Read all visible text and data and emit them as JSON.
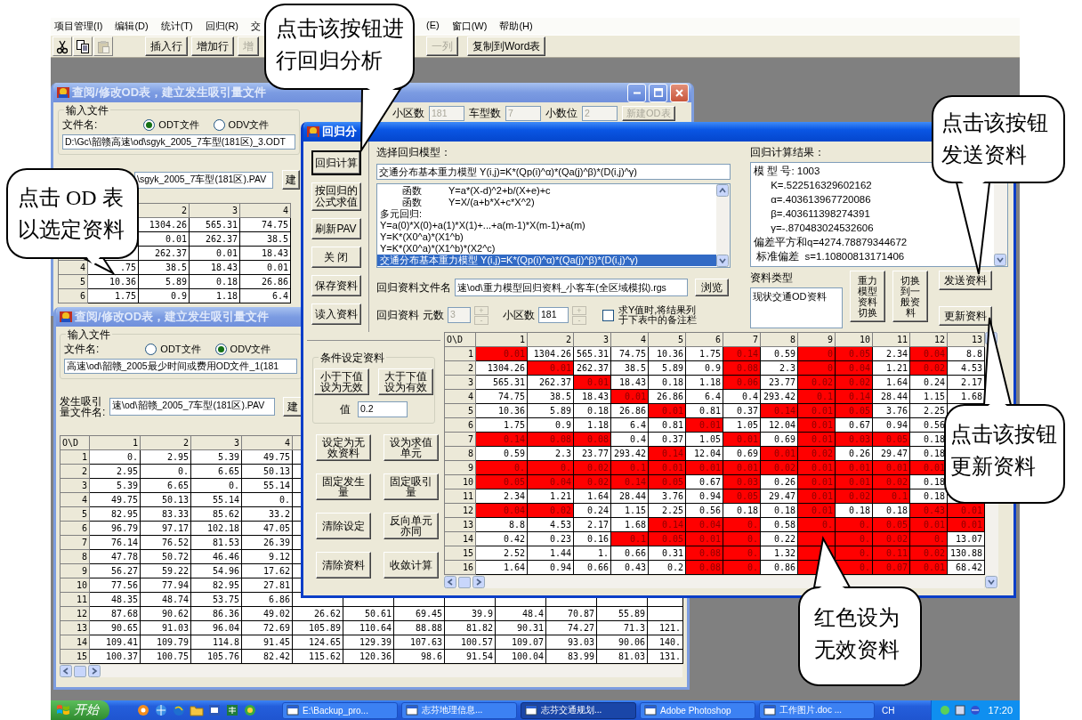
{
  "menu": {
    "left": [
      {
        "label": "项目管理(I)"
      },
      {
        "label": "编辑(D)"
      },
      {
        "label": "统计(T)"
      },
      {
        "label": "回归(R)"
      },
      {
        "label": "交"
      }
    ],
    "right": [
      {
        "label": "(E)"
      },
      {
        "label": "窗口(W)"
      },
      {
        "label": "帮助(H)"
      }
    ]
  },
  "toolbar": {
    "tools": [
      {
        "kind": "cut",
        "disabled": false
      },
      {
        "kind": "copy",
        "disabled": false
      },
      {
        "kind": "paste",
        "disabled": true
      }
    ],
    "left": [
      {
        "label": "插入行",
        "disabled": false
      },
      {
        "label": "增加行",
        "disabled": false
      },
      {
        "label": "增",
        "disabled": true
      }
    ],
    "right": [
      {
        "label": "一列",
        "disabled": true
      },
      {
        "label": "复制到Word表",
        "disabled": false
      }
    ]
  },
  "od_window": {
    "title": "查阅/修改OD表，建立发生吸引量文件",
    "group": "输入文件",
    "file_label": "文件名:",
    "radios": [
      {
        "label": "ODT文件",
        "selected": true
      },
      {
        "label": "ODV文件",
        "selected": false
      }
    ],
    "file": "D:\\Gc\\韶赣高速\\od\\sgyk_2005_7车型(181区)_3.ODT",
    "settings": [
      {
        "label": "小区数",
        "value": "181",
        "disabled": true
      },
      {
        "label": "车型数",
        "value": "7",
        "disabled": true
      },
      {
        "label": "小数位",
        "value": "2",
        "disabled": true
      }
    ],
    "new_button": {
      "label": "新建OD表",
      "disabled": true
    },
    "pav_file": "\\sgyk_2005_7车型(181区).PAV",
    "build_button": "建",
    "table": {
      "columns": [
        "2",
        "3",
        "4"
      ],
      "rows": [
        {
          "cells": [
            "1304.26",
            "565.31",
            "74.75"
          ]
        },
        {
          "cells": [
            "0.01",
            "262.37",
            "38.5"
          ]
        },
        {
          "cells": [
            "262.37",
            "0.01",
            "18.43"
          ]
        },
        {
          "header": "4",
          "first": ".75",
          "cells": [
            "38.5",
            "18.43",
            "0.01"
          ]
        },
        {
          "header": "5",
          "first": "10.36",
          "cells": [
            "5.89",
            "0.18",
            "26.86"
          ]
        },
        {
          "header": "6",
          "first": "1.75",
          "cells": [
            "0.9",
            "1.18",
            "6.4"
          ]
        }
      ]
    }
  },
  "od_window_front": {
    "title": "查阅/修改OD表，建立发生吸引量文件",
    "group": "输入文件",
    "file_label": "文件名:",
    "radios": [
      {
        "label": "ODT文件",
        "selected": false
      },
      {
        "label": "ODV文件",
        "selected": true
      }
    ],
    "file": "高速\\od\\韶赣_2005最少时间或费用OD文件_1(181",
    "pav_label": "发生吸引量文件名:",
    "pav_file": "速\\od\\韶赣_2005_7车型(181区).PAV",
    "build_button": "建",
    "table": {
      "corner": "O\\D",
      "columns": [
        "1",
        "2",
        "3",
        "4"
      ],
      "rows": [
        {
          "header": "1",
          "cells": [
            "0.",
            "2.95",
            "5.39",
            "49.75"
          ]
        },
        {
          "header": "2",
          "cells": [
            "2.95",
            "0.",
            "6.65",
            "50.13"
          ]
        },
        {
          "header": "3",
          "cells": [
            "5.39",
            "6.65",
            "0.",
            "55.14"
          ]
        },
        {
          "header": "4",
          "cells": [
            "49.75",
            "50.13",
            "55.14",
            "0."
          ]
        },
        {
          "header": "5",
          "cells": [
            "82.95",
            "83.33",
            "85.62",
            "33.2"
          ]
        },
        {
          "header": "6",
          "cells": [
            "96.79",
            "97.17",
            "102.18",
            "47.05"
          ]
        },
        {
          "header": "7",
          "cells": [
            "76.14",
            "76.52",
            "81.53",
            "26.39"
          ]
        },
        {
          "header": "8",
          "cells": [
            "47.78",
            "50.72",
            "46.46",
            "9.12"
          ]
        },
        {
          "header": "9",
          "cells": [
            "56.27",
            "59.22",
            "54.96",
            "17.62"
          ]
        },
        {
          "header": "10",
          "cells": [
            "77.56",
            "77.94",
            "82.95",
            "27.81"
          ]
        },
        {
          "header": "11",
          "cells": [
            "48.35",
            "48.74",
            "53.75",
            "6.86"
          ]
        },
        {
          "header": "12",
          "cells": [
            "87.68",
            "90.62",
            "86.36",
            "49.02",
            "26.62",
            "50.61",
            "69.45",
            "39.9",
            "48.4",
            "70.87",
            "55.89"
          ]
        },
        {
          "header": "13",
          "cells": [
            "90.65",
            "91.03",
            "96.04",
            "72.69",
            "105.89",
            "110.64",
            "88.88",
            "81.82",
            "90.31",
            "74.27",
            "71.3",
            "121."
          ]
        },
        {
          "header": "14",
          "cells": [
            "109.41",
            "109.79",
            "114.8",
            "91.45",
            "124.65",
            "129.39",
            "107.63",
            "100.57",
            "109.07",
            "93.03",
            "90.06",
            "140."
          ]
        },
        {
          "header": "15",
          "cells": [
            "100.37",
            "100.75",
            "105.76",
            "82.42",
            "115.62",
            "120.36",
            "98.6",
            "91.54",
            "100.04",
            "83.99",
            "81.03",
            "131."
          ]
        }
      ]
    }
  },
  "regression_dialog": {
    "title": "回归分",
    "side_buttons": [
      {
        "label": "回归计算",
        "focused": true
      },
      {
        "label": "按回归的公式求值",
        "focused": false
      },
      {
        "label": "刷新PAV",
        "focused": false
      },
      {
        "label": "关 闭",
        "focused": false
      },
      {
        "label": "保存资料",
        "focused": false
      },
      {
        "label": "读入资料",
        "focused": false
      }
    ],
    "model_label": "选择回归模型：",
    "model_value": "交通分布基本重力模型 Y(i,j)=K*(Qp(i)^α)*(Qa(j)^β)*(D(i,j)^γ)",
    "model_list": [
      {
        "kind": "function",
        "label": "函数",
        "text": "Y=a*(X-d)^2+b/(X+e)+c",
        "selected": false
      },
      {
        "kind": "function",
        "label": "函数",
        "text": "Y=X/(a+b*X+c*X^2)",
        "selected": false
      },
      {
        "kind": "plain",
        "text": "多元回归:",
        "selected": false
      },
      {
        "kind": "plain",
        "text": "Y=a(0)*X(0)+a(1)*X(1)+...+a(m-1)*X(m-1)+a(m)",
        "selected": false
      },
      {
        "kind": "plain",
        "text": "Y=K*(X0^a)*(X1^b)",
        "selected": false
      },
      {
        "kind": "plain",
        "text": "Y=K*(X0^a)*(X1^b)*(X2^c)",
        "selected": false
      },
      {
        "kind": "plain",
        "text": "交通分布基本重力模型 Y(i,j)=K*(Qp(i)^α)*(Qa(j)^β)*(D(i,j)^γ)",
        "selected": true
      }
    ],
    "file_label": "回归资料文件名",
    "file": "速\\od\\重力模型回归资料_小客车(全区域模拟).rgs",
    "browse_button": "浏览",
    "dims": {
      "label": "回归资料",
      "var_label": "元数",
      "var_value": "3",
      "var_disabled": true,
      "zone_label": "小区数",
      "zone_value": "181",
      "spin_up": "+",
      "spin_down": "-",
      "spinners_disabled": true,
      "checkbox": {
        "label": "求Y值时,将结果列于下表中的备注栏",
        "checked": false
      }
    },
    "result_label": "回归计算结果：",
    "result_lines": [
      "模 型 号: 1003",
      "      K=.522516329602162",
      "      α=.403613967720086",
      "      β=.403611398274391",
      "      γ=-.870483024532606",
      "偏差平方和q=4274.78879344672",
      " 标准偏差  s=1.10800813171406"
    ],
    "data_type_label": "资料类型",
    "data_type": "现状交通OD资料",
    "switch_buttons": [
      "重力模型资料切换",
      "切换到一般资料"
    ],
    "send_button": "发送资料",
    "update_button": "更新资料",
    "condition": {
      "group": "条件设定资料",
      "buttons": [
        "小于下值设为无效",
        "大于下值设为有效"
      ],
      "value_label": "值",
      "value": "0.2"
    },
    "cond_buttons": [
      "设定为无效资料",
      "设为求值单元",
      "固定发生量",
      "固定吸引量",
      "清除设定",
      "反向单元亦同",
      "清除资料",
      "收敛计算"
    ],
    "table": {
      "corner": "O\\D",
      "columns": [
        "1",
        "2",
        "3",
        "4",
        "5",
        "6",
        "7",
        "8",
        "9",
        "10",
        "11",
        "12",
        "13"
      ],
      "rows": [
        {
          "header": "1",
          "cells": [
            "0.01",
            "1304.26",
            "565.31",
            "74.75",
            "10.36",
            "1.75",
            "0.14",
            "0.59",
            "0",
            "0.05",
            "2.34",
            "0.04",
            "8.8"
          ],
          "invalid": [
            true,
            false,
            false,
            false,
            false,
            false,
            true,
            false,
            true,
            true,
            false,
            true,
            false
          ]
        },
        {
          "header": "2",
          "cells": [
            "1304.26",
            "0.01",
            "262.37",
            "38.5",
            "5.89",
            "0.9",
            "0.08",
            "2.3",
            "0",
            "0.04",
            "1.21",
            "0.02",
            "4.53"
          ],
          "invalid": [
            false,
            true,
            false,
            false,
            false,
            false,
            true,
            false,
            true,
            true,
            false,
            true,
            false
          ]
        },
        {
          "header": "3",
          "cells": [
            "565.31",
            "262.37",
            "0.01",
            "18.43",
            "0.18",
            "1.18",
            "0.06",
            "23.77",
            "0.02",
            "0.02",
            "1.64",
            "0.24",
            "2.17"
          ],
          "invalid": [
            false,
            false,
            true,
            false,
            false,
            false,
            true,
            false,
            true,
            true,
            false,
            false,
            false
          ]
        },
        {
          "header": "4",
          "cells": [
            "74.75",
            "38.5",
            "18.43",
            "0.01",
            "26.86",
            "6.4",
            "0.4",
            "293.42",
            "0.1",
            "0.14",
            "28.44",
            "1.15",
            "1.68"
          ],
          "invalid": [
            false,
            false,
            false,
            true,
            false,
            false,
            false,
            false,
            true,
            true,
            false,
            false,
            false
          ]
        },
        {
          "header": "5",
          "cells": [
            "10.36",
            "5.89",
            "0.18",
            "26.86",
            "0.01",
            "0.81",
            "0.37",
            "0.14",
            "0.01",
            "0.05",
            "3.76",
            "2.25"
          ],
          "invalid": [
            false,
            false,
            false,
            false,
            true,
            false,
            false,
            true,
            true,
            true,
            false,
            false
          ]
        },
        {
          "header": "6",
          "cells": [
            "1.75",
            "0.9",
            "1.18",
            "6.4",
            "0.81",
            "0.01",
            "1.05",
            "12.04",
            "0.01",
            "0.67",
            "0.94",
            "0.56"
          ],
          "invalid": [
            false,
            false,
            false,
            false,
            false,
            true,
            false,
            false,
            true,
            false,
            false,
            false
          ]
        },
        {
          "header": "7",
          "cells": [
            "0.14",
            "0.08",
            "0.08",
            "0.4",
            "0.37",
            "1.05",
            "0.01",
            "0.69",
            "0.01",
            "0.03",
            "0.05",
            "0.18"
          ],
          "invalid": [
            true,
            true,
            true,
            false,
            false,
            false,
            true,
            false,
            true,
            true,
            true,
            false
          ]
        },
        {
          "header": "8",
          "cells": [
            "0.59",
            "2.3",
            "23.77",
            "293.42",
            "0.14",
            "12.04",
            "0.69",
            "0.01",
            "0.02",
            "0.26",
            "29.47",
            "0.18"
          ],
          "invalid": [
            false,
            false,
            false,
            false,
            true,
            false,
            false,
            true,
            true,
            false,
            false,
            false
          ]
        },
        {
          "header": "9",
          "cells": [
            "0.",
            "0.",
            "0.02",
            "0.1",
            "0.01",
            "0.01",
            "0.01",
            "0.02",
            "0.01",
            "0.01",
            "0.01",
            "0.01"
          ],
          "invalid": [
            true,
            true,
            true,
            true,
            true,
            true,
            true,
            true,
            true,
            true,
            true,
            true
          ]
        },
        {
          "header": "10",
          "cells": [
            "0.05",
            "0.04",
            "0.02",
            "0.14",
            "0.05",
            "0.67",
            "0.03",
            "0.26",
            "0.01",
            "0.01",
            "0.02",
            "0.18"
          ],
          "invalid": [
            true,
            true,
            true,
            true,
            true,
            false,
            true,
            false,
            true,
            true,
            true,
            false
          ]
        },
        {
          "header": "11",
          "cells": [
            "2.34",
            "1.21",
            "1.64",
            "28.44",
            "3.76",
            "0.94",
            "0.05",
            "29.47",
            "0.01",
            "0.02",
            "0.1",
            "0.18"
          ],
          "invalid": [
            false,
            false,
            false,
            false,
            false,
            false,
            true,
            false,
            true,
            true,
            true,
            false
          ]
        },
        {
          "header": "12",
          "cells": [
            "0.04",
            "0.02",
            "0.24",
            "1.15",
            "2.25",
            "0.56",
            "0.18",
            "0.18",
            "0.01",
            "0.18",
            "0.18",
            "0.43",
            "0.01"
          ],
          "invalid": [
            true,
            true,
            false,
            false,
            false,
            false,
            false,
            false,
            true,
            false,
            false,
            true,
            true
          ]
        },
        {
          "header": "13",
          "cells": [
            "8.8",
            "4.53",
            "2.17",
            "1.68",
            "0.14",
            "0.04",
            "0.",
            "0.58",
            "0.",
            "0.",
            "0.05",
            "0.01",
            "0.01"
          ],
          "invalid": [
            false,
            false,
            false,
            false,
            true,
            true,
            true,
            false,
            true,
            true,
            true,
            true,
            true
          ]
        },
        {
          "header": "14",
          "cells": [
            "0.42",
            "0.23",
            "0.16",
            "0.1",
            "0.05",
            "0.01",
            "0.",
            "0.22",
            null,
            "0.",
            "0.02",
            "0.",
            "13.07"
          ],
          "invalid": [
            false,
            false,
            false,
            true,
            true,
            true,
            true,
            false,
            true,
            true,
            true,
            true,
            false
          ]
        },
        {
          "header": "15",
          "cells": [
            "2.52",
            "1.44",
            "1.",
            "0.66",
            "0.31",
            "0.08",
            "0.",
            "1.32",
            null,
            "0.",
            "0.11",
            "0.02",
            "130.88"
          ],
          "invalid": [
            false,
            false,
            false,
            false,
            false,
            true,
            true,
            false,
            true,
            true,
            true,
            true,
            false
          ]
        },
        {
          "header": "16",
          "cells": [
            "1.64",
            "0.94",
            "0.66",
            "0.43",
            "0.2",
            "0.08",
            "0.",
            "0.86",
            null,
            "0.",
            "0.07",
            "0.01",
            "68.42"
          ],
          "invalid": [
            false,
            false,
            false,
            false,
            false,
            true,
            true,
            false,
            true,
            true,
            true,
            true,
            false
          ]
        }
      ]
    }
  },
  "callouts": [
    {
      "text": "点击该按钮进行回归分析"
    },
    {
      "text": "点击 OD 表以选定资料"
    },
    {
      "text": "点击该按钮发送资料"
    },
    {
      "text": "点击该按钮更新资料"
    },
    {
      "text": "红色设为无效资料"
    }
  ],
  "taskbar": {
    "start": "开始",
    "tasks": [
      {
        "label": "E:\\Backup_pro...",
        "selected": false
      },
      {
        "label": "志芬地理信息...",
        "selected": false
      },
      {
        "label": "志芬交通规划...",
        "selected": true
      },
      {
        "label": "Adobe Photoshop",
        "selected": false
      },
      {
        "label": "工作图片.doc ...",
        "selected": false
      }
    ],
    "language": "CH",
    "clock": "17:20"
  }
}
